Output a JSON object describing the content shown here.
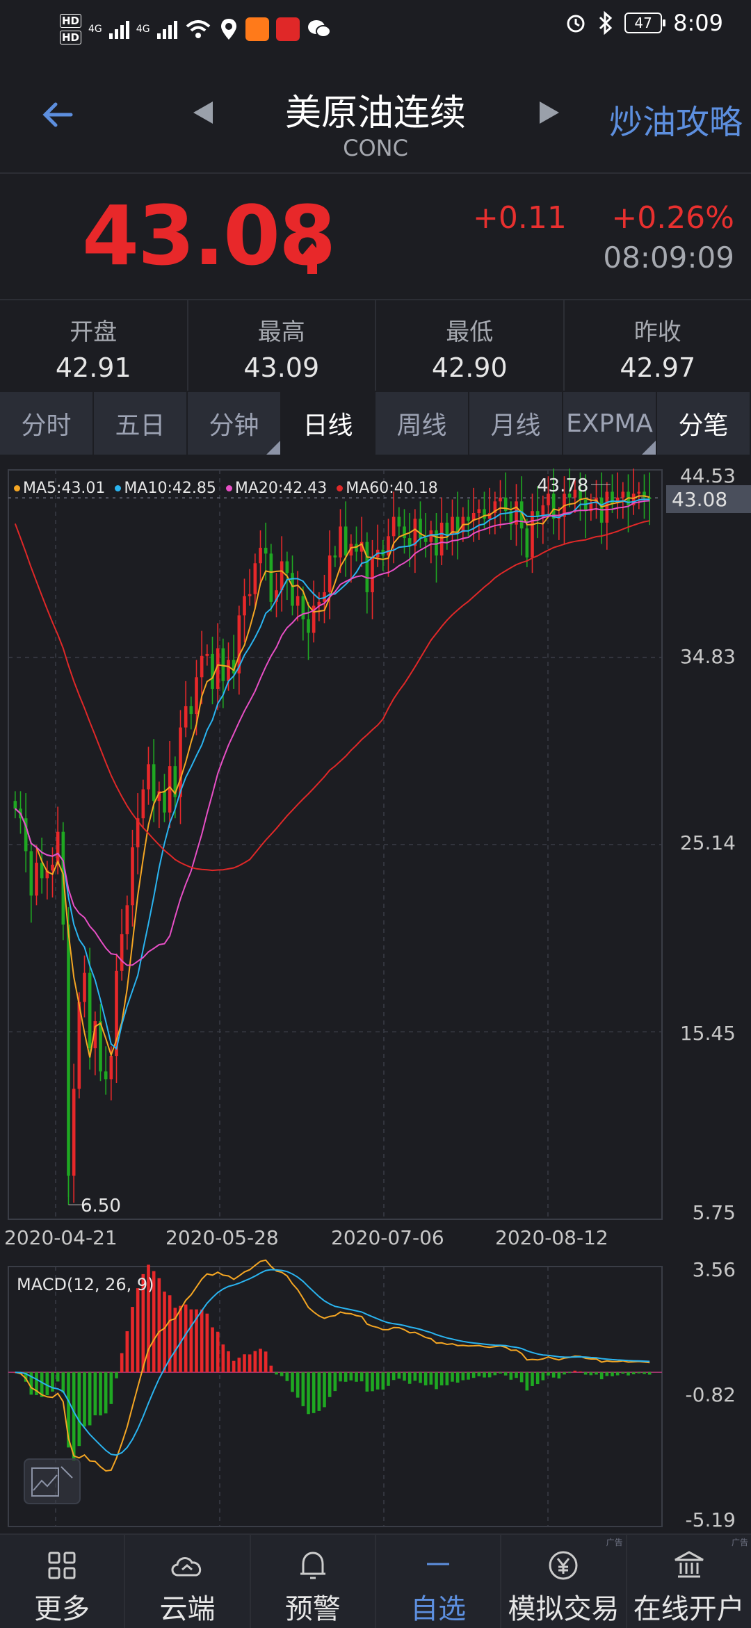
{
  "status_bar": {
    "network": [
      "HD",
      "HD"
    ],
    "signal_labels": [
      "4G",
      "4G"
    ],
    "battery": "47",
    "time": "8:09"
  },
  "header": {
    "title": "美原油连续",
    "subtitle": "CONC",
    "right_link": "炒油攻略"
  },
  "quote": {
    "price": "43.08",
    "change": "+0.11",
    "change_pct": "+0.26%",
    "timestamp": "08:09:09",
    "price_color": "#e8282a"
  },
  "stats": [
    {
      "label": "开盘",
      "value": "42.91"
    },
    {
      "label": "最高",
      "value": "43.09"
    },
    {
      "label": "最低",
      "value": "42.90"
    },
    {
      "label": "昨收",
      "value": "42.97"
    }
  ],
  "tabs": [
    "分时",
    "五日",
    "分钟",
    "日线",
    "周线",
    "月线",
    "EXPMA",
    "分笔"
  ],
  "active_tab": "日线",
  "chart": {
    "legend": [
      {
        "label": "MA5:43.01",
        "color": "#f5a623"
      },
      {
        "label": "MA10:42.85",
        "color": "#2ab4f0"
      },
      {
        "label": "MA20:42.43",
        "color": "#e84fc6"
      },
      {
        "label": "MA60:40.18",
        "color": "#e02828"
      }
    ],
    "y_ticks": [
      "44.53",
      "34.83",
      "25.14",
      "15.45",
      "5.75"
    ],
    "current_tag": "43.08",
    "high_annotation": "43.78",
    "low_annotation": "6.50",
    "x_ticks": [
      "2020-04-21",
      "2020-05-28",
      "2020-07-06",
      "2020-08-12"
    ],
    "macd_label": "MACD(12, 26, 9)",
    "macd_ticks": [
      "3.56",
      "-0.82",
      "-5.19"
    ]
  },
  "chart_data": {
    "type": "candlestick",
    "title": "",
    "xlabel": "",
    "ylabel": "",
    "ylim": [
      5.75,
      44.53
    ],
    "x_ticks": [
      "2020-04-21",
      "2020-05-28",
      "2020-07-06",
      "2020-08-12"
    ],
    "close": [
      27.0,
      26.5,
      24.8,
      22.5,
      24.2,
      23.4,
      23.8,
      24.1,
      25.8,
      21.0,
      8.0,
      12.5,
      17.0,
      18.5,
      14.6,
      16.0,
      13.4,
      13.0,
      14.2,
      18.6,
      20.5,
      22.0,
      25.0,
      26.5,
      28.0,
      29.3,
      27.4,
      27.9,
      26.8,
      29.2,
      27.6,
      31.2,
      32.3,
      31.9,
      33.8,
      34.9,
      35.0,
      33.2,
      35.3,
      33.6,
      34.7,
      34.0,
      37.0,
      38.0,
      38.1,
      39.7,
      40.5,
      40.2,
      37.7,
      38.3,
      39.8,
      39.2,
      37.5,
      38.0,
      36.8,
      36.1,
      37.5,
      37.7,
      38.2,
      40.1,
      40.0,
      41.6,
      40.1,
      40.7,
      40.3,
      40.8,
      38.2,
      40.0,
      40.4,
      40.1,
      41.1,
      42.1,
      41.6,
      41.0,
      40.6,
      42.0,
      41.0,
      40.8,
      41.4,
      40.1,
      41.8,
      41.2,
      42.1,
      41.3,
      42.1,
      41.9,
      42.3,
      42.5,
      42.0,
      42.3,
      42.9,
      43.1,
      42.4,
      41.7,
      42.9,
      41.5,
      40.0,
      42.4,
      42.1,
      42.7,
      43.3,
      42.0,
      42.1,
      43.3,
      43.1,
      43.5,
      43.0,
      42.4,
      42.8,
      43.1,
      41.8,
      43.4,
      42.8,
      43.1,
      43.4,
      42.7,
      43.3,
      43.4,
      43.1,
      43.08
    ],
    "series": [
      {
        "name": "MA5",
        "last": 43.01
      },
      {
        "name": "MA10",
        "last": 42.85
      },
      {
        "name": "MA20",
        "last": 42.43
      },
      {
        "name": "MA60",
        "last": 40.18
      }
    ],
    "high_label": 43.78,
    "low_label": 6.5,
    "macd": {
      "params": "12, 26, 9",
      "ylim": [
        -5.19,
        3.56
      ]
    }
  },
  "nav": [
    {
      "label": "更多",
      "icon": "grid-icon"
    },
    {
      "label": "云端",
      "icon": "cloud-sync-icon"
    },
    {
      "label": "预警",
      "icon": "bell-icon"
    },
    {
      "label": "自选",
      "icon": "dash-icon"
    },
    {
      "label": "模拟交易",
      "icon": "yen-coin-icon"
    },
    {
      "label": "在线开户",
      "icon": "bank-icon"
    }
  ],
  "ad_tag": "广告",
  "colors": {
    "up": "#e8282a",
    "down": "#1fa822",
    "accent": "#5d8fdf"
  }
}
